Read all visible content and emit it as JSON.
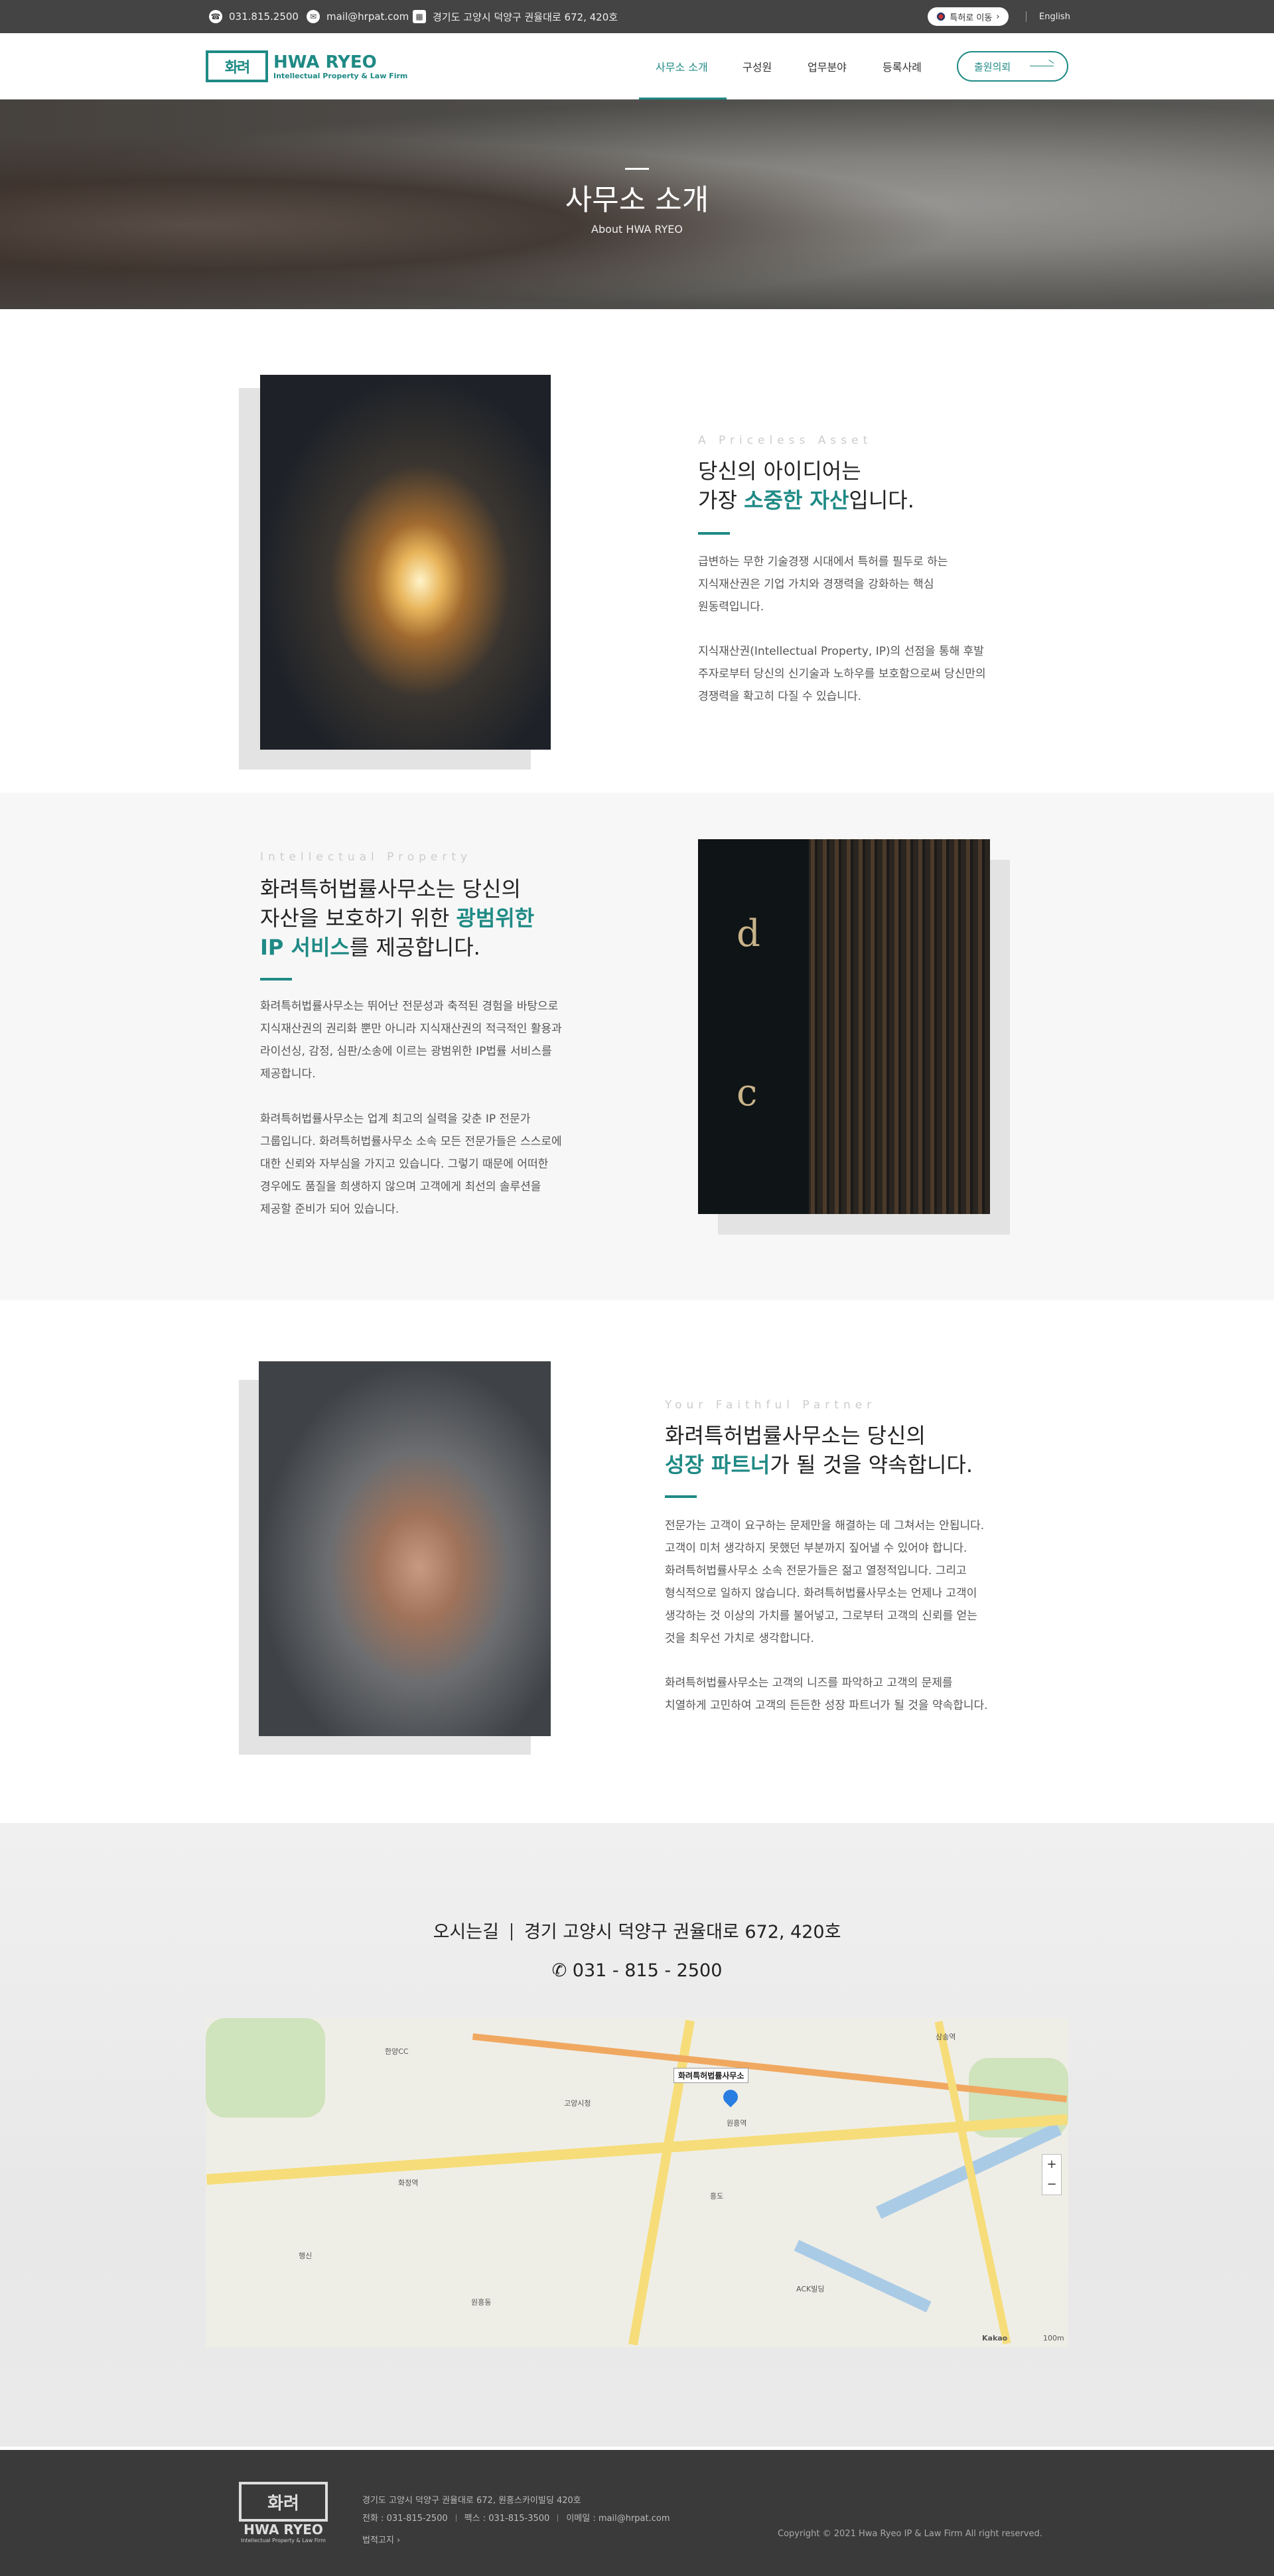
{
  "topbar": {
    "phone": "031.815.2500",
    "email": "mail@hrpat.com",
    "address": "경기도 고양시 덕양구 권율대로 672, 420호",
    "patent_button": "특허로 이동",
    "lang": "English"
  },
  "header": {
    "logo_mark": "화려",
    "logo_title": "HWA RYEO",
    "logo_subtitle": "Intellectual Property & Law Firm",
    "nav": [
      "사무소 소개",
      "구성원",
      "업무분야",
      "등록사례"
    ],
    "active_nav": "사무소 소개",
    "consult_button": "출원의뢰"
  },
  "hero": {
    "title": "사무소 소개",
    "subtitle": "About HWA RYEO"
  },
  "section1": {
    "eyebrow": "A Priceless Asset",
    "heading_line1": "당신의 아이디어는",
    "heading_line2_pre": "가장 ",
    "heading_line2_hl": "소중한 자산",
    "heading_line2_post": "입니다.",
    "paragraphs": [
      [
        "급변하는 무한 기술경쟁 시대에서 특허를 필두로 하는",
        "지식재산권은 기업 가치와 경쟁력을 강화하는 핵심",
        "원동력입니다."
      ],
      [
        "지식재산권(Intellectual Property, IP)의 선점을 통해 후발",
        "주자로부터 당신의 신기술과 노하우를 보호함으로써 당신만의",
        "경쟁력을 확고히 다질 수 있습니다."
      ]
    ]
  },
  "section2": {
    "eyebrow": "Intellectual Property",
    "heading_line1": "화려특허법률사무소는 당신의",
    "heading_line2_pre": "자산을 보호하기 위한 ",
    "heading_line2_hl": "광범위한",
    "heading_line3_hl": "IP 서비스",
    "heading_line3_post": "를 제공합니다.",
    "book_letters": [
      "d",
      "c"
    ],
    "paragraphs": [
      [
        "화려특허법률사무소는 뛰어난 전문성과 축적된 경험을 바탕으로",
        "지식재산권의 권리화 뿐만 아니라 지식재산권의 적극적인 활용과",
        "라이선싱, 감정, 심판/소송에 이르는 광범위한 IP법률 서비스를",
        "제공합니다."
      ],
      [
        "화려특허법률사무소는 업계 최고의 실력을 갖춘 IP 전문가",
        "그룹입니다. 화려특허법률사무소 소속 모든 전문가들은 스스로에",
        "대한 신뢰와 자부심을 가지고 있습니다. 그렇기 때문에 어떠한",
        "경우에도 품질을 희생하지 않으며 고객에게 최선의 솔루션을",
        "제공할 준비가 되어 있습니다."
      ]
    ]
  },
  "section3": {
    "eyebrow": "Your Faithful Partner",
    "heading_line1": "화려특허법률사무소는 당신의",
    "heading_line2_hl": "성장 파트너",
    "heading_line2_post": "가 될 것을 약속합니다.",
    "paragraphs": [
      [
        "전문가는 고객이 요구하는 문제만을 해결하는 데 그쳐서는 안됩니다.",
        "고객이 미처 생각하지 못했던 부분까지 짚어낼 수 있어야 합니다.",
        "화려특허법률사무소 소속 전문가들은 젊고 열정적입니다. 그리고",
        "형식적으로 일하지 않습니다. 화려특허법률사무소는 언제나 고객이",
        "생각하는 것 이상의 가치를 불어넣고, 그로부터 고객의 신뢰를 얻는",
        "것을 최우선 가치로 생각합니다."
      ],
      [
        "화려특허법률사무소는 고객의 니즈를 파악하고 고객의 문제를",
        "치열하게 고민하여 고객의 든든한 성장 파트너가 될 것을 약속합니다."
      ]
    ]
  },
  "location": {
    "label": "오시는길",
    "address": "경기 고양시 덕양구 권율대로 672, 420호",
    "phone": "031 - 815 - 2500",
    "map_pin": "화려특허법률사무소",
    "map_labels": [
      "한양CC",
      "원흥역",
      "삼송역",
      "화정역",
      "고양시청",
      "흥도",
      "행신",
      "ACK빌딩",
      "원흥동"
    ],
    "map_scale": "100m",
    "map_brand": "Kakao"
  },
  "footer": {
    "logo_mark": "화려",
    "logo_title": "HWA RYEO",
    "logo_subtitle": "Intellectual Property & Law Firm",
    "address": "경기도 고양시 덕양구 권율대로 672, 원흥스카이빌딩 420호",
    "tel": "전화 : 031-815-2500",
    "fax": "팩스 : 031-815-3500",
    "email": "이메일 : mail@hrpat.com",
    "privacy": "법적고지",
    "copyright": "Copyright © 2021 Hwa Ryeo IP & Law Firm All right reserved."
  },
  "colors": {
    "accent": "#1f8a85",
    "topbar": "#444444",
    "footer": "#3a3a3a"
  },
  "icons": [
    "phone-icon",
    "mail-icon",
    "building-icon",
    "flag-icon",
    "arrow-right-icon",
    "phone-solid-icon"
  ]
}
